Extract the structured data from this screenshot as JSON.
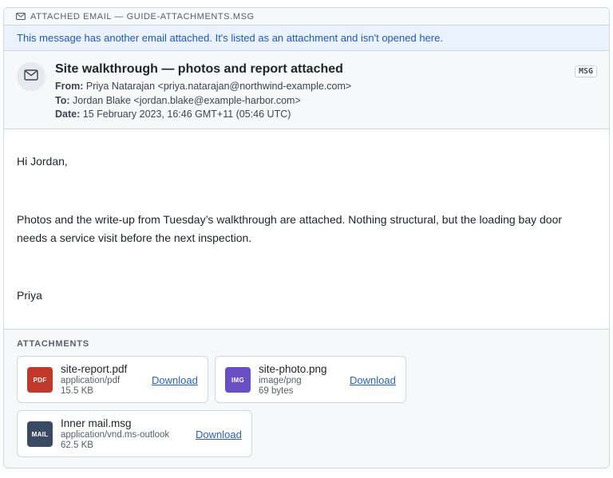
{
  "topbar": {
    "label": "ATTACHED EMAIL — GUIDE-ATTACHMENTS.MSG",
    "icon": "envelope-icon"
  },
  "banner": {
    "text": "This message has another email attached. It's listed as an attachment and isn't opened here."
  },
  "header": {
    "avatar_icon": "envelope-icon",
    "subject": "Site walkthrough — photos and report attached",
    "from_label": "From:",
    "from_value": "Priya Natarajan <priya.natarajan@northwind-example.com>",
    "to_label": "To:",
    "to_value": "Jordan Blake <jordan.blake@example-harbor.com>",
    "date_label": "Date:",
    "date_value": "15 February 2023, 16:46 GMT+11 (05:46 UTC)",
    "badge": "MSG"
  },
  "body": {
    "greeting": "Hi Jordan,",
    "paragraph": "Photos and the write-up from Tuesday’s walkthrough are attached. Nothing structural, but the loading bay door needs a service visit before the next inspection.",
    "signoff": "Priya"
  },
  "attachments": {
    "title": "ATTACHMENTS",
    "download_label": "Download",
    "items": [
      {
        "badge": "PDF",
        "color": "#c0392b",
        "name": "site-report.pdf",
        "type": "application/pdf",
        "size": "15.5 KB"
      },
      {
        "badge": "IMG",
        "color": "#6a4fc4",
        "name": "site-photo.png",
        "type": "image/png",
        "size": "69 bytes"
      },
      {
        "badge": "MAIL",
        "color": "#3b4a63",
        "name": "Inner mail.msg",
        "type": "application/vnd.ms-outlook",
        "size": "62.5 KB"
      }
    ]
  }
}
